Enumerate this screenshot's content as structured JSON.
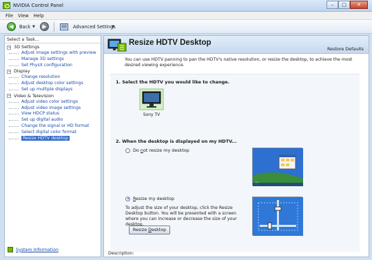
{
  "window": {
    "title": "NVIDIA Control Panel",
    "controls": {
      "minimize": "–",
      "maximize": "□",
      "close": "✕"
    }
  },
  "menu": [
    "File",
    "View",
    "Help"
  ],
  "toolbar": {
    "back_label": "Back",
    "advanced_settings_label": "Advanced Settings"
  },
  "left_panel": {
    "header": "Select a Task...",
    "categories": [
      {
        "label": "3D Settings",
        "expander": "−",
        "tasks": [
          "Adjust image settings with preview",
          "Manage 3D settings",
          "Set PhysX configuration"
        ]
      },
      {
        "label": "Display",
        "expander": "−",
        "tasks": [
          "Change resolution",
          "Adjust desktop color settings",
          "Set up multiple displays"
        ]
      },
      {
        "label": "Video & Television",
        "expander": "−",
        "tasks": [
          "Adjust video color settings",
          "Adjust video image settings",
          "View HDCP status",
          "Set up digital audio",
          "Change the signal or HD format",
          "Select digital color format",
          "Resize HDTV desktop"
        ]
      }
    ],
    "selected_task": "Resize HDTV desktop",
    "system_information": "System Information"
  },
  "content": {
    "title": "Resize HDTV Desktop",
    "restore_defaults": "Restore Defaults",
    "description": "You can use HDTV panning to pan the HDTV's native resolution, or resize the desktop, to achieve the most desired viewing experience.",
    "step1": "1. Select the HDTV you would like to change.",
    "tv_name": "Sony TV",
    "step2": "2. When the desktop is displayed on my HDTV...",
    "option_no_resize": {
      "prefix": "Do ",
      "mnemonic": "n",
      "rest": "ot resize my desktop",
      "checked": false
    },
    "option_resize": {
      "prefix": "",
      "mnemonic": "R",
      "rest": "esize my desktop",
      "checked": true
    },
    "resize_description": "To adjust the size of your desktop, click the Resize Desktop button.  You will be presented with a screen where you can increase or decrease the size of your desktop.",
    "resize_button": {
      "prefix": "Resize ",
      "mnemonic": "D",
      "rest": "esktop"
    },
    "description_label": "Description:"
  },
  "colors": {
    "nvidia_green": "#76b900",
    "link_blue": "#1848a6",
    "selection_blue": "#3168c8"
  }
}
